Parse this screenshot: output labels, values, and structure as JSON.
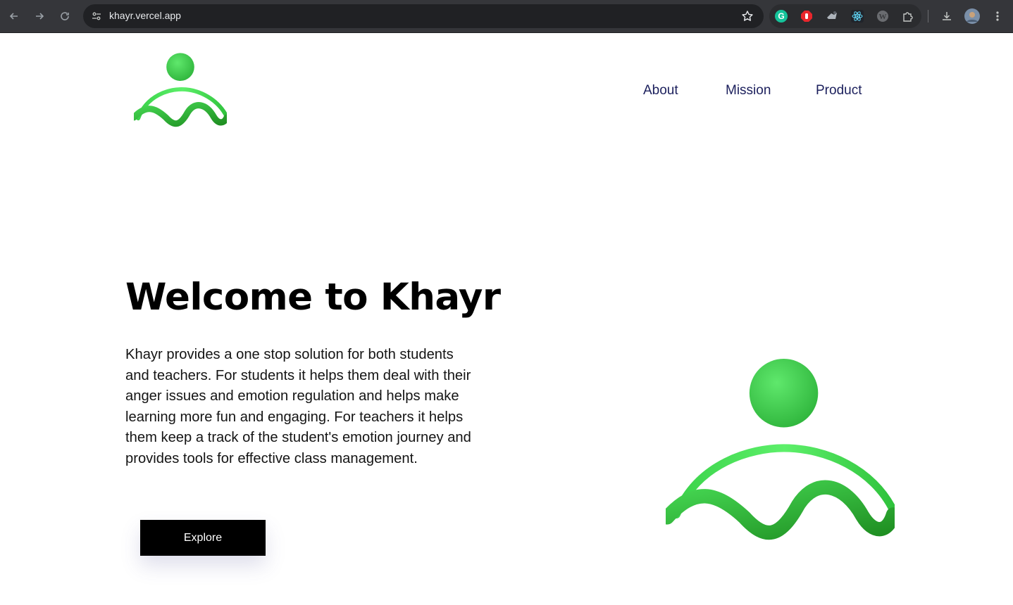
{
  "browser": {
    "url": "khayr.vercel.app",
    "extensions": [
      "grammarly-icon",
      "adblock-icon",
      "extension-icon",
      "react-devtools-icon",
      "wordpress-icon",
      "puzzle-icon"
    ]
  },
  "nav": {
    "items": [
      {
        "label": "About"
      },
      {
        "label": "Mission"
      },
      {
        "label": "Product"
      }
    ]
  },
  "hero": {
    "title": "Welcome to Khayr",
    "description": "Khayr provides a one stop solution for both students and teachers. For students it helps them deal with their anger issues and emotion regulation and helps make learning more fun and engaging. For teachers it helps them keep a track of the student's emotion journey and provides tools for effective class management.",
    "cta_label": "Explore"
  },
  "colors": {
    "brand_green": "#3fd44f",
    "brand_green_dark": "#229a25",
    "nav_text": "#1b1f5c",
    "button_bg": "#000000"
  }
}
